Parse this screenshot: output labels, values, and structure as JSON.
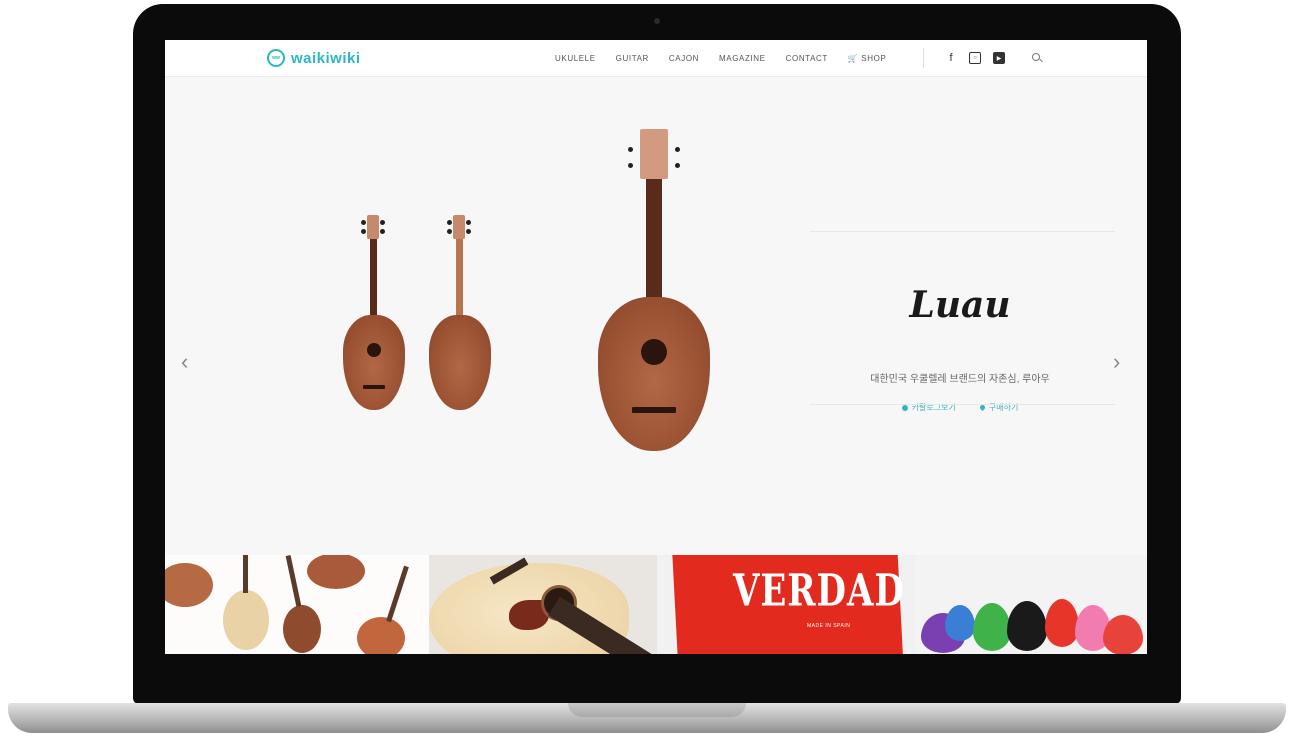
{
  "site": {
    "logo_text": "waikiwiki",
    "logo_badge": "ww"
  },
  "nav": {
    "items": [
      "UKULELE",
      "GUITAR",
      "CAJON",
      "MAGAZINE",
      "CONTACT",
      "SHOP"
    ]
  },
  "social": {
    "facebook": "f"
  },
  "hero": {
    "brand": "Luau",
    "tagline": "대한민국 우쿨렐레 브랜드의 자존심, 루아우",
    "link_1": "카탈로그보기",
    "link_2": "구매하기",
    "prev": "‹",
    "next": "›"
  },
  "banners": {
    "verdad": "VERDAD",
    "verdad_sub": "MADE IN SPAIN"
  },
  "colors": {
    "accent": "#2bb8c4",
    "verdad_red": "#e32a1f"
  }
}
